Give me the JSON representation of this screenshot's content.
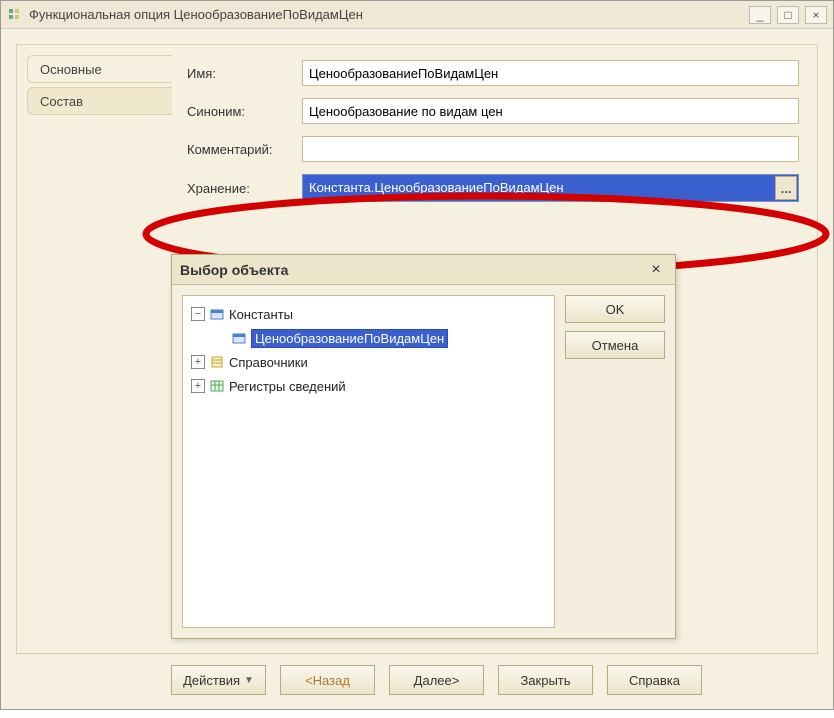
{
  "window": {
    "title": "Функциональная опция ЦенообразованиеПоВидамЦен",
    "controls": {
      "min": "_",
      "max": "□",
      "close": "×"
    }
  },
  "tabs": {
    "main": "Основные",
    "composition": "Состав"
  },
  "form": {
    "name_label": "Имя:",
    "name_value": "ЦенообразованиеПоВидамЦен",
    "synonym_label": "Синоним:",
    "synonym_value": "Ценообразование по видам цен",
    "comment_label": "Комментарий:",
    "comment_value": "",
    "storage_label": "Хранение:",
    "storage_value": "Константа.ЦенообразованиеПоВидамЦен",
    "ellipsis": "..."
  },
  "dialog": {
    "title": "Выбор объекта",
    "close": "×",
    "ok": "OK",
    "cancel": "Отмена",
    "tree": {
      "constants": "Константы",
      "constants_item": "ЦенообразованиеПоВидамЦен",
      "catalogs": "Справочники",
      "info_registers": "Регистры сведений",
      "exp_minus": "−",
      "exp_plus": "+"
    }
  },
  "footer": {
    "actions": "Действия",
    "back": "<Назад",
    "next": "Далее>",
    "close": "Закрыть",
    "help": "Справка"
  }
}
